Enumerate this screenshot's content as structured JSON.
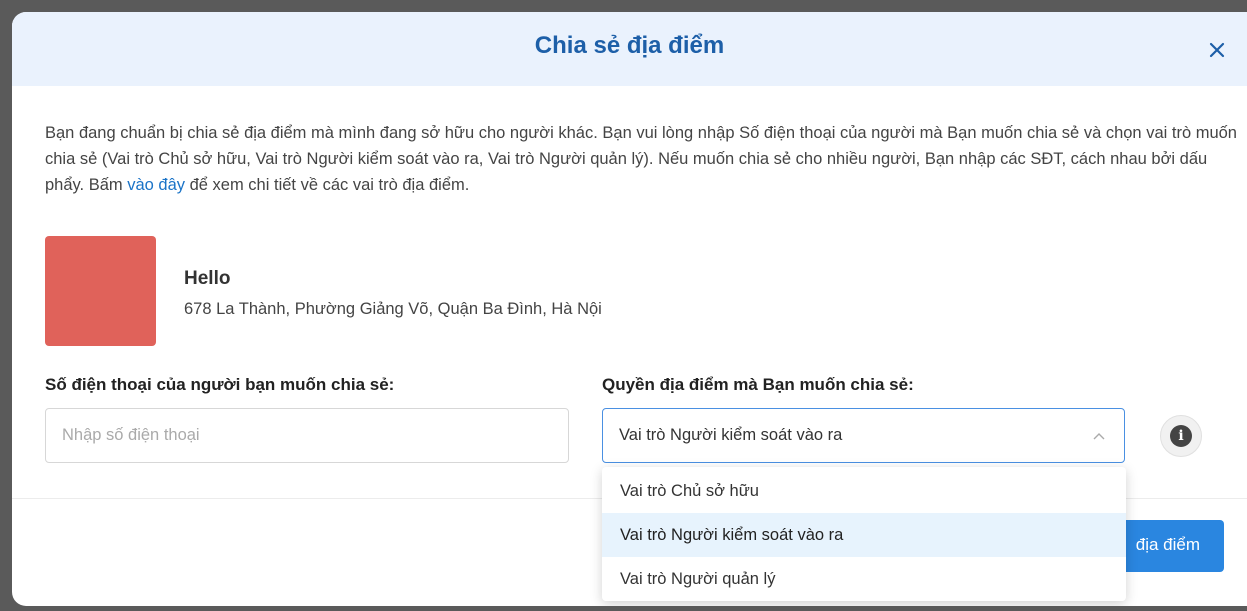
{
  "modal": {
    "title": "Chia sẻ địa điểm",
    "description_before_link": "Bạn đang chuẩn bị chia sẻ địa điểm mà mình đang sở hữu cho người khác. Bạn vui lòng nhập Số điện thoại của người mà Bạn muốn chia sẻ và chọn vai trò muốn chia sẻ (Vai trò Chủ sở hữu, Vai trò Người kiểm soát vào ra, Vai trò Người quản lý). Nếu muốn chia sẻ cho nhiều người, Bạn nhập các SĐT, cách nhau bởi dấu phẩy. Bấm ",
    "description_link": "vào đây",
    "description_after_link": " để xem chi tiết về các vai trò địa điểm."
  },
  "location": {
    "name": "Hello",
    "address": "678 La Thành, Phường Giảng Võ, Quận Ba Đình, Hà Nội",
    "thumbnail_color": "#e0625a"
  },
  "form": {
    "phone_label": "Số điện thoại của người bạn muốn chia sẻ:",
    "phone_placeholder": "Nhập số điện thoại",
    "role_label": "Quyền địa điểm mà Bạn muốn chia sẻ:",
    "role_selected": "Vai trò Người kiểm soát vào ra",
    "role_options": [
      "Vai trò Chủ sở hữu",
      "Vai trò Người kiểm soát vào ra",
      "Vai trò Người quản lý"
    ]
  },
  "footer": {
    "submit_label": "địa điểm"
  },
  "icons": {
    "close": "close-icon",
    "chevron": "chevron-up-icon",
    "info": "info-icon"
  },
  "colors": {
    "accent": "#1d5fa8",
    "link": "#1a73c7",
    "button": "#2a86e0",
    "header_bg": "#eaf2fd"
  }
}
